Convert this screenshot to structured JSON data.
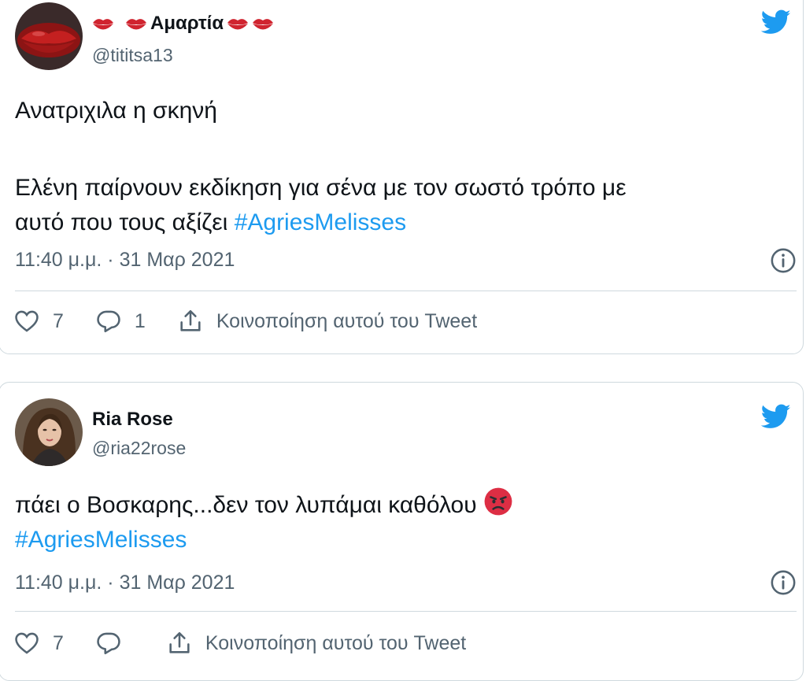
{
  "tweets": [
    {
      "display_name": "Αμαρτία",
      "handle": "@tititsa13",
      "text_line1": "Ανατριχιλα η σκηνή",
      "text_line2": "Ελένη παίρνουν εκδίκηση για σένα με τον σωστό τρόπο με",
      "text_line3": "αυτό που τους αξίζει",
      "hashtag": "#AgriesMelisses",
      "timestamp": "11:40 μ.μ. · 31 Μαρ 2021",
      "like_count": "7",
      "reply_count": "1",
      "share_label": "Κοινοποίηση αυτού του Tweet"
    },
    {
      "display_name": "Ria Rose",
      "handle": "@ria22rose",
      "text_line1": "πάει ο Βοσκαρης...δεν τον λυπάμαι καθόλου",
      "hashtag": "#AgriesMelisses",
      "timestamp": "11:40 μ.μ. · 31 Μαρ 2021",
      "like_count": "7",
      "reply_count": "",
      "share_label": "Κοινοποίηση αυτού του Tweet"
    }
  ],
  "colors": {
    "accent": "#1d9bf0",
    "secondary_text": "#536471",
    "border": "#cfd9de",
    "lips": "#d0242f"
  },
  "icons": [
    "twitter-bird-icon",
    "info-icon",
    "heart-icon",
    "reply-icon",
    "share-icon",
    "lips-icon",
    "angry-face-icon"
  ]
}
